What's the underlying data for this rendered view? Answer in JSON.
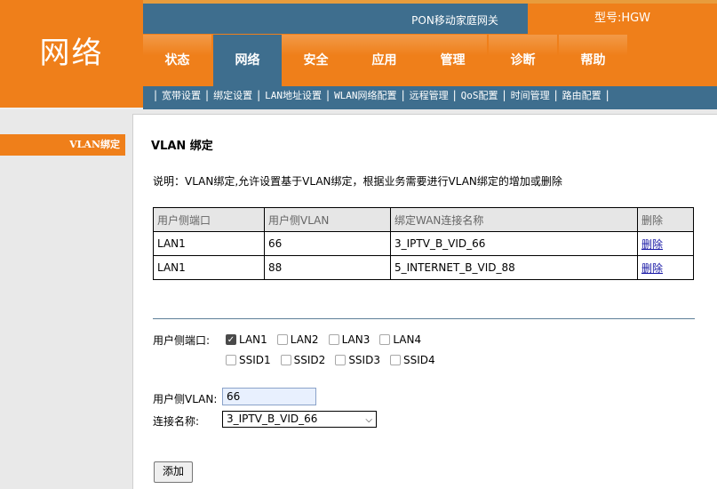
{
  "header": {
    "section_title": "网络",
    "gateway_title": "PON移动家庭网关",
    "model_label": "型号:HGW",
    "nav_tabs": [
      {
        "label": "状态"
      },
      {
        "label": "网络"
      },
      {
        "label": "安全"
      },
      {
        "label": "应用"
      },
      {
        "label": "管理"
      },
      {
        "label": "诊断"
      },
      {
        "label": "帮助"
      }
    ],
    "active_tab": "网络",
    "sub_nav": [
      {
        "label": "宽带设置"
      },
      {
        "label": "绑定设置"
      },
      {
        "label": "LAN地址设置"
      },
      {
        "label": "WLAN网络配置"
      },
      {
        "label": "远程管理"
      },
      {
        "label": "QoS配置"
      },
      {
        "label": "时间管理"
      },
      {
        "label": "路由配置"
      }
    ]
  },
  "sidebar": {
    "active_item": "VLAN绑定"
  },
  "main": {
    "title": "VLAN 绑定",
    "description": "说明：VLAN绑定,允许设置基于VLAN绑定，根据业务需要进行VLAN绑定的增加或删除",
    "table": {
      "headers": [
        "用户侧端口",
        "用户侧VLAN",
        "绑定WAN连接名称",
        "删除"
      ],
      "rows": [
        {
          "port": "LAN1",
          "vlan": "66",
          "wan": "3_IPTV_B_VID_66",
          "delete": "删除"
        },
        {
          "port": "LAN1",
          "vlan": "88",
          "wan": "5_INTERNET_B_VID_88",
          "delete": "删除"
        }
      ]
    },
    "form": {
      "port_label": "用户侧端口:",
      "ports": [
        {
          "label": "LAN1",
          "checked": true
        },
        {
          "label": "LAN2",
          "checked": false
        },
        {
          "label": "LAN3",
          "checked": false
        },
        {
          "label": "LAN4",
          "checked": false
        }
      ],
      "ssids": [
        {
          "label": "SSID1",
          "checked": false
        },
        {
          "label": "SSID2",
          "checked": false
        },
        {
          "label": "SSID3",
          "checked": false
        },
        {
          "label": "SSID4",
          "checked": false
        }
      ],
      "vlan_label": "用户侧VLAN:",
      "vlan_value": "66",
      "conn_label": "连接名称:",
      "conn_value": "3_IPTV_B_VID_66",
      "add_label": "添加"
    }
  },
  "colors": {
    "orange": "#ef7f1a",
    "blue": "#3e6e8e"
  }
}
